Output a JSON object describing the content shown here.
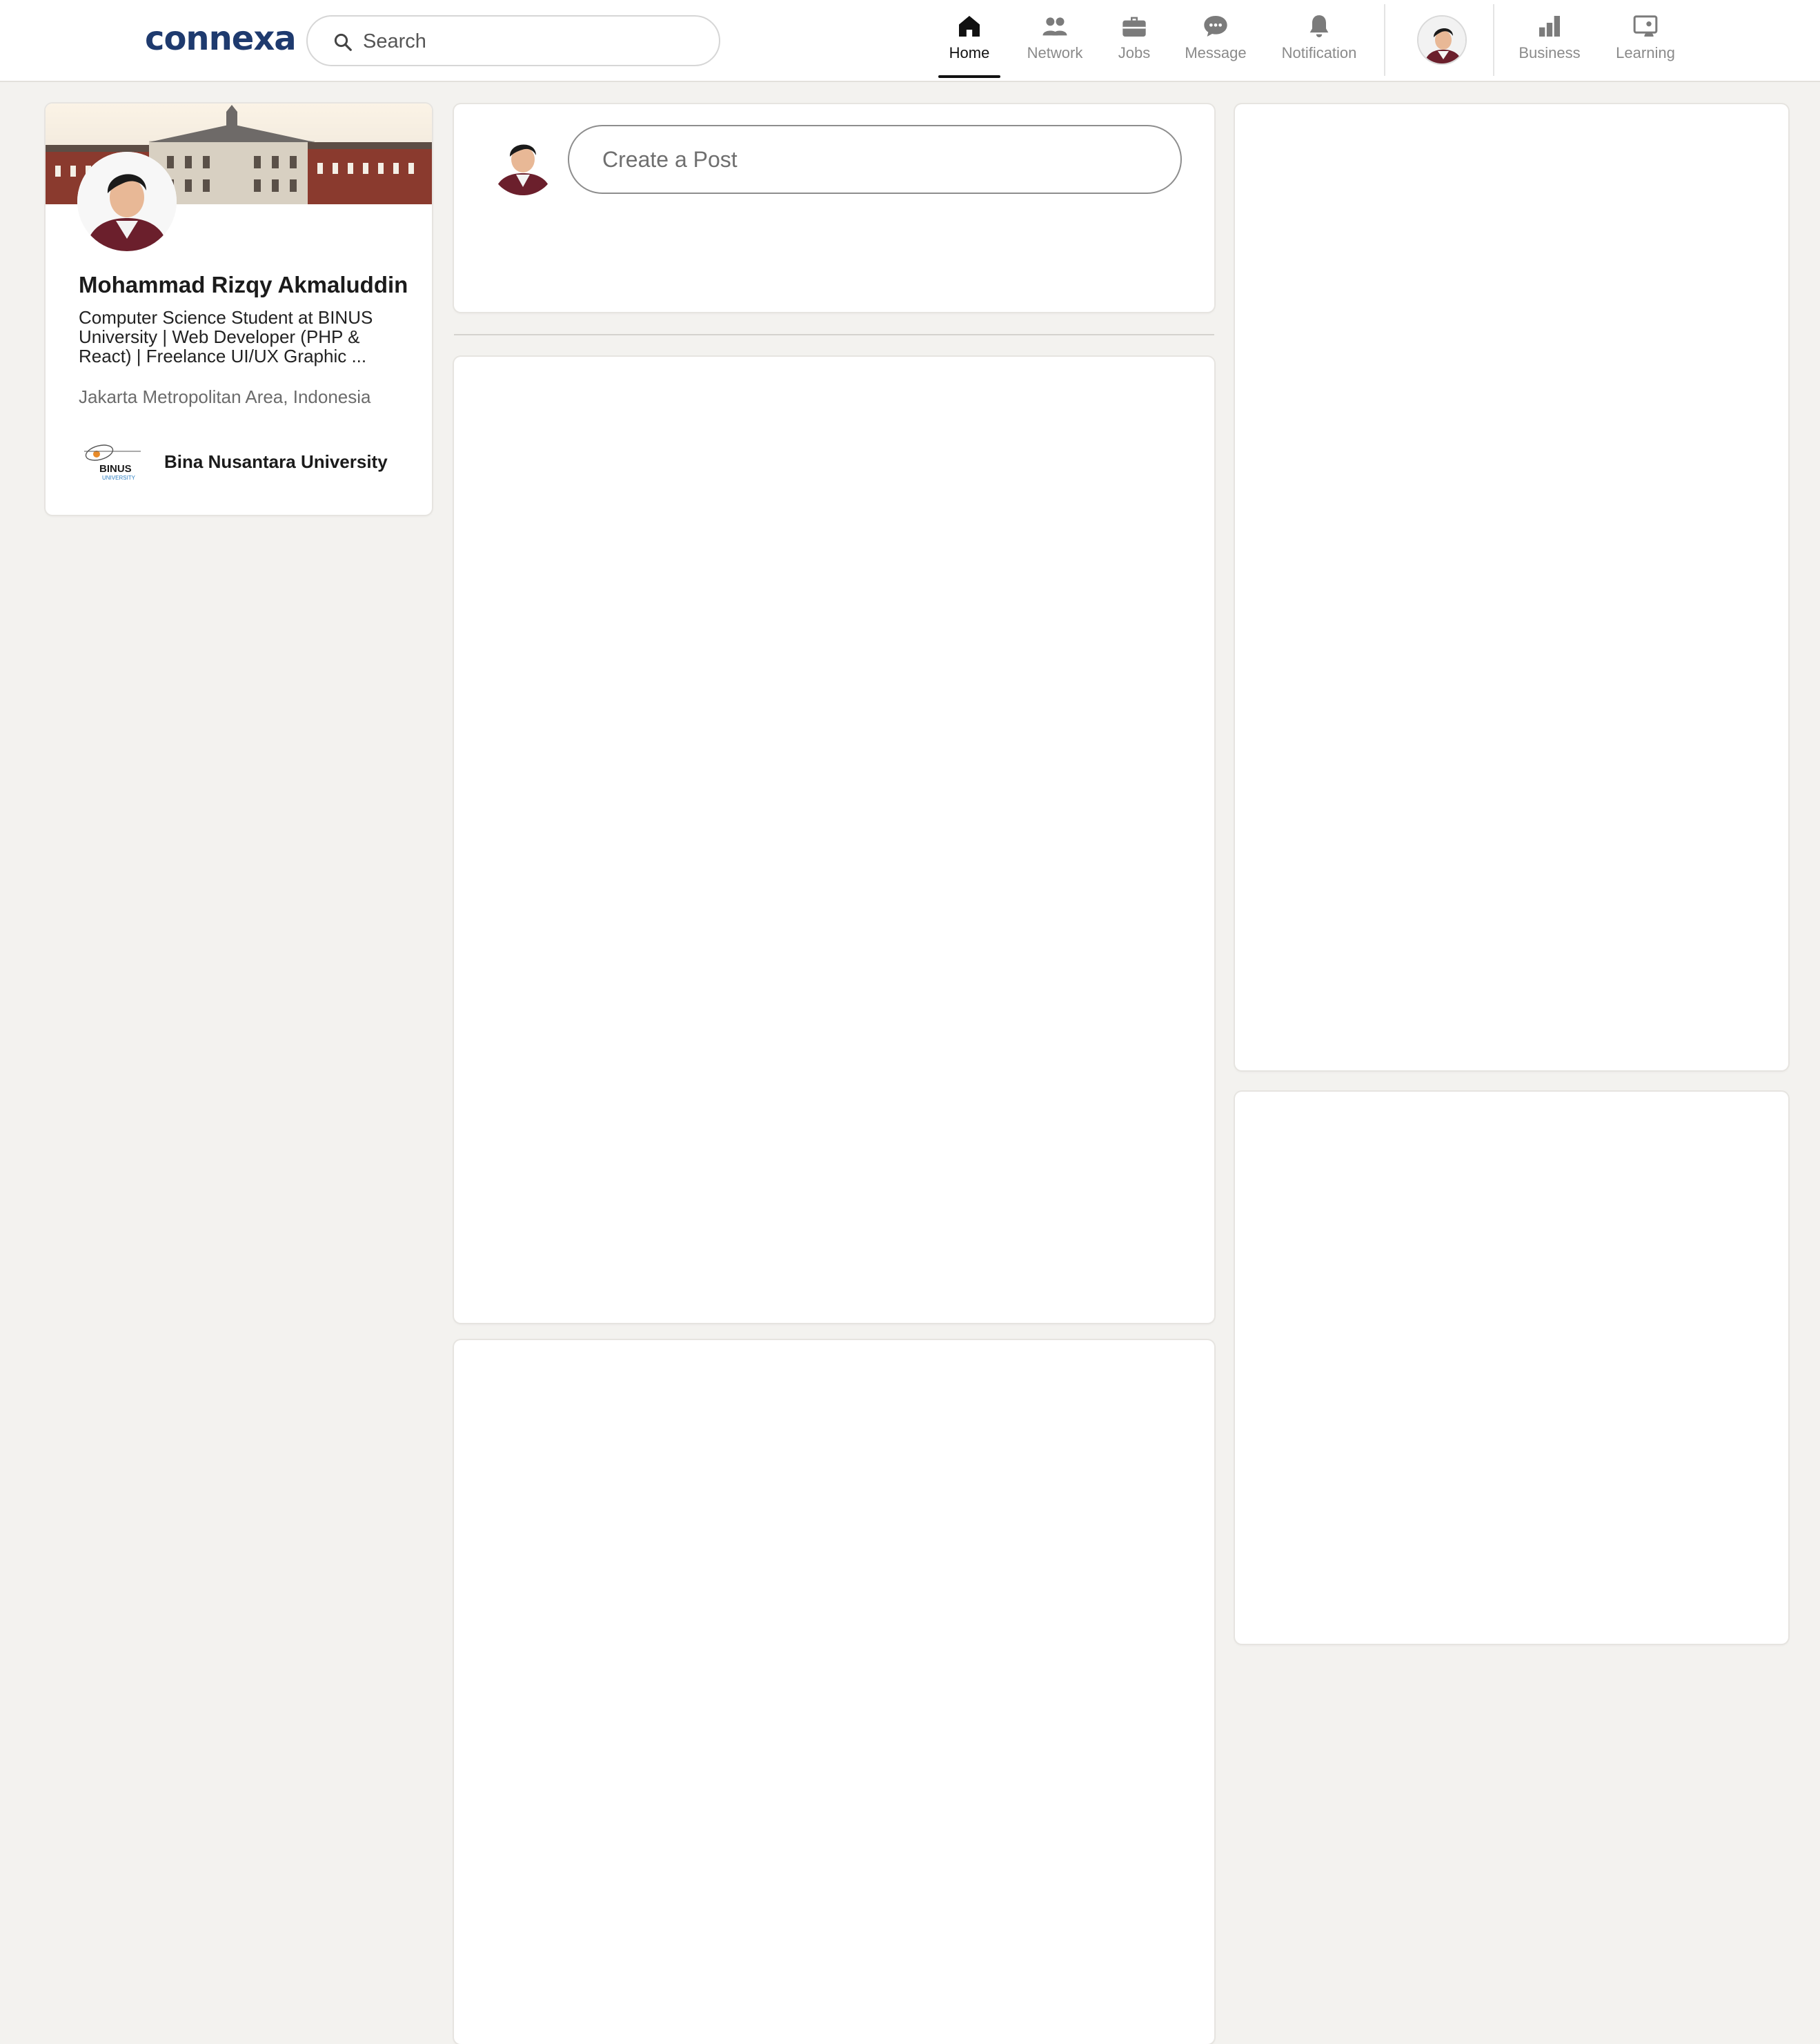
{
  "brand": {
    "logo_text": "connexa",
    "color": "#1e3a6e"
  },
  "search": {
    "placeholder": "Search",
    "icon": "search-icon"
  },
  "nav": {
    "items": [
      {
        "label": "Home",
        "icon": "home-icon",
        "active": true
      },
      {
        "label": "Network",
        "icon": "network-icon",
        "active": false
      },
      {
        "label": "Jobs",
        "icon": "briefcase-icon",
        "active": false
      },
      {
        "label": "Message",
        "icon": "message-icon",
        "active": false
      },
      {
        "label": "Notification",
        "icon": "bell-icon",
        "active": false
      }
    ],
    "extra_items": [
      {
        "label": "Business",
        "icon": "bar-chart-icon"
      },
      {
        "label": "Learning",
        "icon": "learning-icon"
      }
    ]
  },
  "profile": {
    "name": "Mohammad Rizqy Akmaluddin",
    "headline": "Computer Science Student at BINUS University | Web Developer (PHP & React) | Freelance UI/UX Graphic ...",
    "location": "Jakarta Metropolitan Area, Indonesia",
    "education": {
      "name": "Bina Nusantara University",
      "logo_text": "BINUS",
      "logo_subtext": "UNIVERSITY"
    }
  },
  "composer": {
    "placeholder": "Create a Post"
  },
  "colors": {
    "background": "#f3f2ef",
    "card": "#ffffff",
    "nav_muted": "#8a8a8a",
    "active": "#111111"
  }
}
